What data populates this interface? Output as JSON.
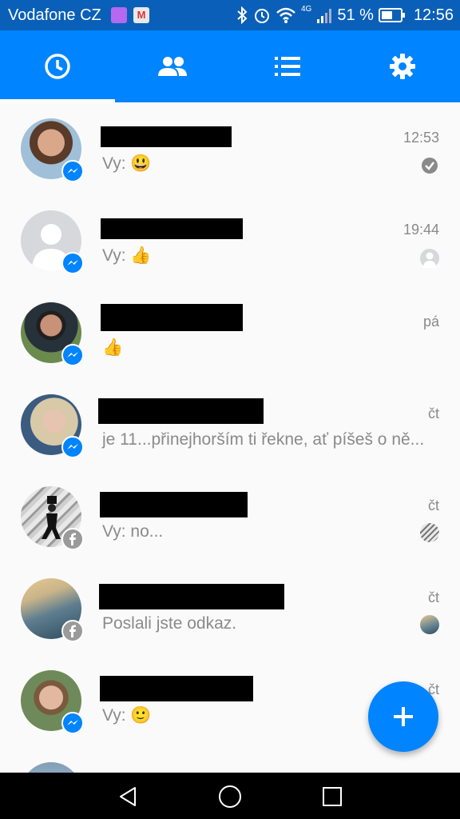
{
  "status_bar": {
    "carrier": "Vodafone CZ",
    "network": "4G",
    "battery_percent": "51 %",
    "time": "12:56",
    "icons": [
      "bluetooth-icon",
      "alarm-icon",
      "wifi-icon",
      "signal-icon",
      "battery-icon"
    ]
  },
  "tabs": [
    {
      "name": "recent",
      "icon": "clock-icon",
      "active": true
    },
    {
      "name": "people",
      "icon": "people-icon",
      "active": false
    },
    {
      "name": "groups",
      "icon": "list-icon",
      "active": false
    },
    {
      "name": "settings",
      "icon": "gear-icon",
      "active": false
    }
  ],
  "conversations": [
    {
      "preview": "Vy: 😃",
      "time": "12:53",
      "source": "messenger",
      "status": "sent-check"
    },
    {
      "preview": "Vy: 👍",
      "time": "19:44",
      "source": "messenger",
      "status": "seen-avatar"
    },
    {
      "preview": "👍",
      "time": "pá",
      "source": "messenger",
      "status": ""
    },
    {
      "preview": "je 11...přinejhorším ti řekne, ať píšeš o ně...",
      "time": "čt",
      "source": "messenger",
      "status": ""
    },
    {
      "preview": "Vy: no...",
      "time": "čt",
      "source": "facebook",
      "status": "seen-avatar"
    },
    {
      "preview": "Poslali jste odkaz.",
      "time": "čt",
      "source": "facebook",
      "status": "seen-avatar"
    },
    {
      "preview": "Vy: 🙂",
      "time": "čt",
      "source": "messenger",
      "status": ""
    }
  ],
  "fab": {
    "icon": "plus-icon"
  },
  "colors": {
    "accent": "#0084ff",
    "status_bar": "#0a60b8",
    "muted_text": "#8a8a8a"
  }
}
